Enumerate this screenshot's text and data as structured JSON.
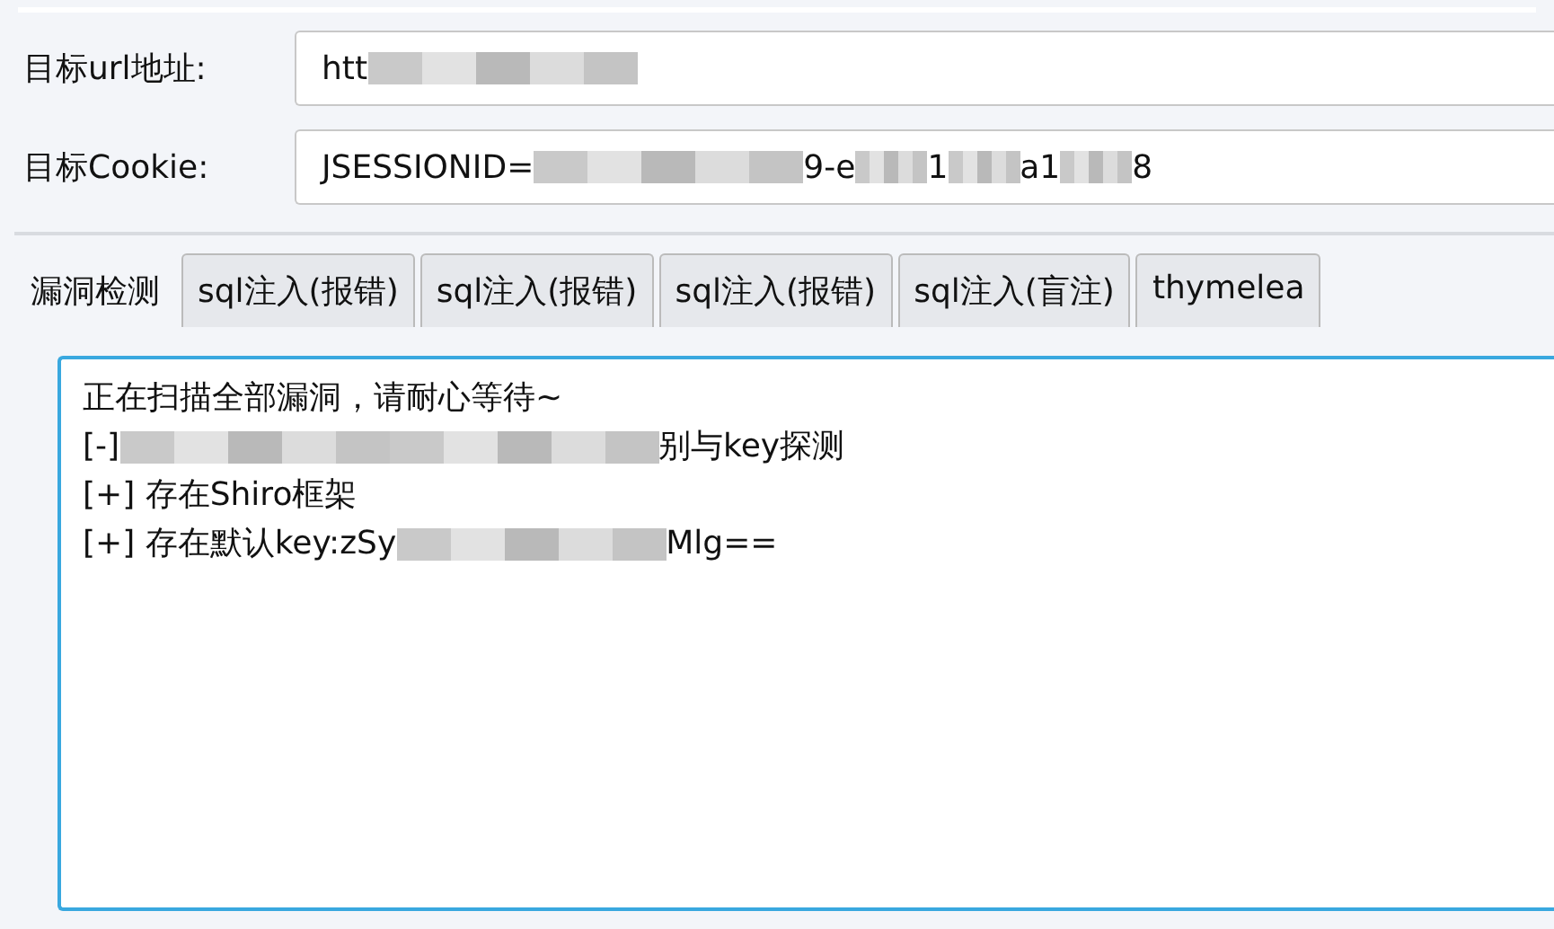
{
  "fields": [
    {
      "label": "目标url地址:",
      "value": [
        {
          "kind": "text",
          "text": "htt"
        },
        {
          "kind": "blur-long"
        }
      ]
    },
    {
      "label": "目标Cookie:",
      "value": [
        {
          "kind": "text",
          "text": "JSESSIONID="
        },
        {
          "kind": "blur-long"
        },
        {
          "kind": "text",
          "text": "9-e"
        },
        {
          "kind": "blur-short"
        },
        {
          "kind": "text",
          "text": "1"
        },
        {
          "kind": "blur-short"
        },
        {
          "kind": "text",
          "text": "a1"
        },
        {
          "kind": "blur-short"
        },
        {
          "kind": "text",
          "text": "8"
        }
      ]
    }
  ],
  "tabs": [
    {
      "label": "漏洞检测",
      "selected": true
    },
    {
      "label": "sql注入(报错)",
      "selected": false
    },
    {
      "label": "sql注入(报错)",
      "selected": false
    },
    {
      "label": "sql注入(报错)",
      "selected": false
    },
    {
      "label": "sql注入(盲注)",
      "selected": false
    },
    {
      "label": "thymelea",
      "selected": false
    }
  ],
  "output_lines": [
    [
      {
        "kind": "text",
        "text": "正在扫描全部漏洞，请耐心等待~"
      }
    ],
    [
      {
        "kind": "text",
        "text": "[-]"
      },
      {
        "kind": "blur-long"
      },
      {
        "kind": "blur-long"
      },
      {
        "kind": "text",
        "text": "别与key探测"
      }
    ],
    [
      {
        "kind": "text",
        "text": "[+] 存在Shiro框架"
      }
    ],
    [
      {
        "kind": "text",
        "text": "[+] 存在默认key:zSy"
      },
      {
        "kind": "blur-long"
      },
      {
        "kind": "text",
        "text": "Mlg=="
      }
    ]
  ]
}
